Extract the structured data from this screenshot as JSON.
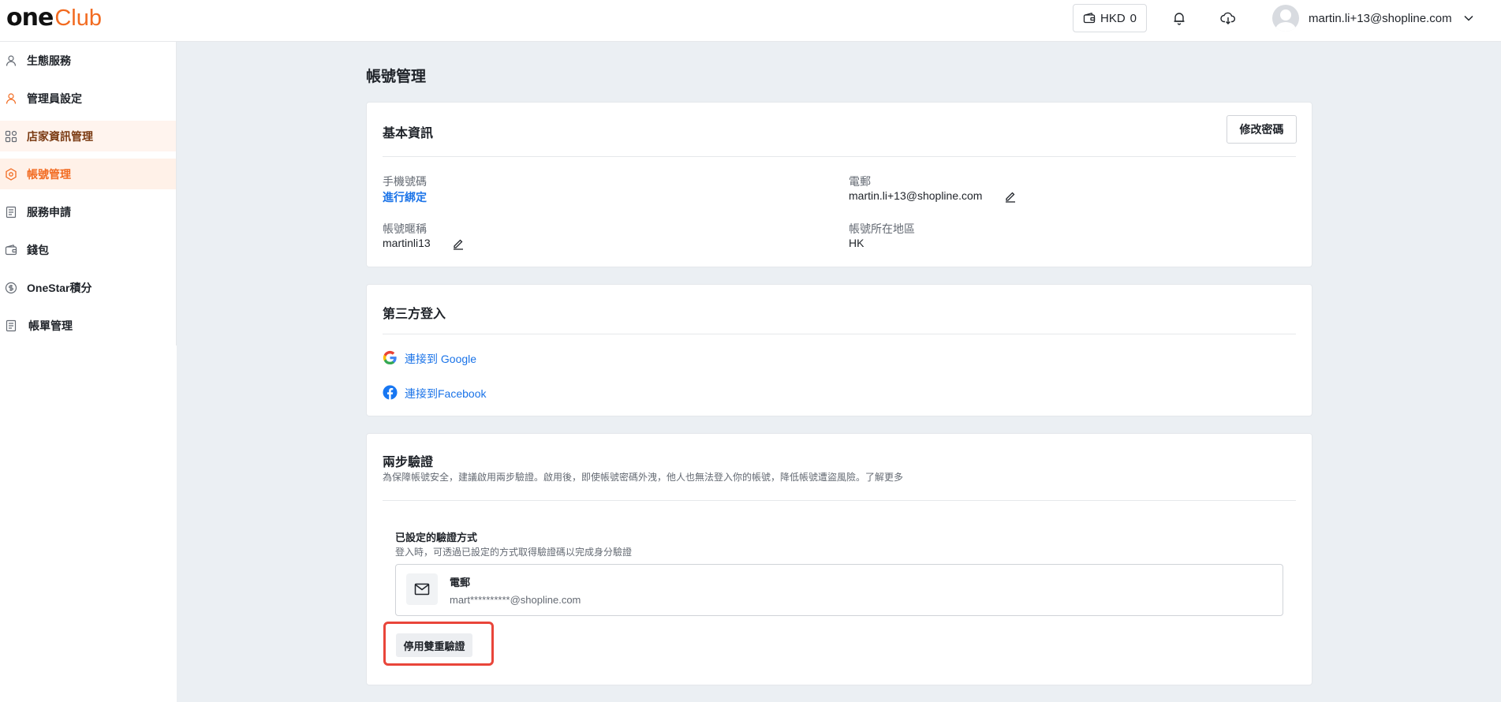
{
  "header": {
    "logo_one": "one",
    "logo_club": "Club",
    "wallet_label": "HKD",
    "wallet_amount": "0",
    "user_email": "martin.li+13@shopline.com",
    "icons": [
      "wallet-icon",
      "bell-icon",
      "cloud-download-icon",
      "chevron-down-icon"
    ]
  },
  "sidebar": {
    "items": [
      {
        "label": "生態服務",
        "icon": "user-icon"
      },
      {
        "label": "管理員設定",
        "icon": "user-icon"
      },
      {
        "label": "店家資訊管理",
        "icon": "grid-icon"
      },
      {
        "label": "帳號管理",
        "icon": "hexagon-icon"
      },
      {
        "label": "服務申請",
        "icon": "document-icon"
      },
      {
        "label": "錢包",
        "icon": "wallet-icon"
      },
      {
        "label": "OneStar積分",
        "icon": "coin-icon"
      },
      {
        "label": "帳單管理",
        "icon": "document-icon"
      }
    ]
  },
  "main": {
    "page_title": "帳號管理",
    "basic": {
      "title": "基本資訊",
      "change_password": "修改密碼",
      "phone_label": "手機號碼",
      "phone_link": "進行綁定",
      "email_label": "電郵",
      "email_value": "martin.li+13@shopline.com",
      "nickname_label": "帳號暱稱",
      "nickname_value": "martinli13",
      "region_label": "帳號所在地區",
      "region_value": "HK"
    },
    "third_party": {
      "title": "第三方登入",
      "google": "連接到 Google",
      "facebook": "連接到Facebook"
    },
    "two_step": {
      "title": "兩步驗證",
      "description": "為保障帳號安全，建議啟用兩步驗證。啟用後，即使帳號密碼外洩，他人也無法登入你的帳號，降低帳號遭盜風險。了解更多",
      "configured_title": "已設定的驗證方式",
      "configured_desc": "登入時，可透過已設定的方式取得驗證碼以完成身分驗證",
      "method_name": "電郵",
      "method_value": "mart**********@shopline.com",
      "disable_button": "停用雙重驗證"
    }
  },
  "colors": {
    "accent": "#f26b21",
    "link": "#1a73e8",
    "highlight": "#e9453a",
    "background": "#ebeff3"
  }
}
